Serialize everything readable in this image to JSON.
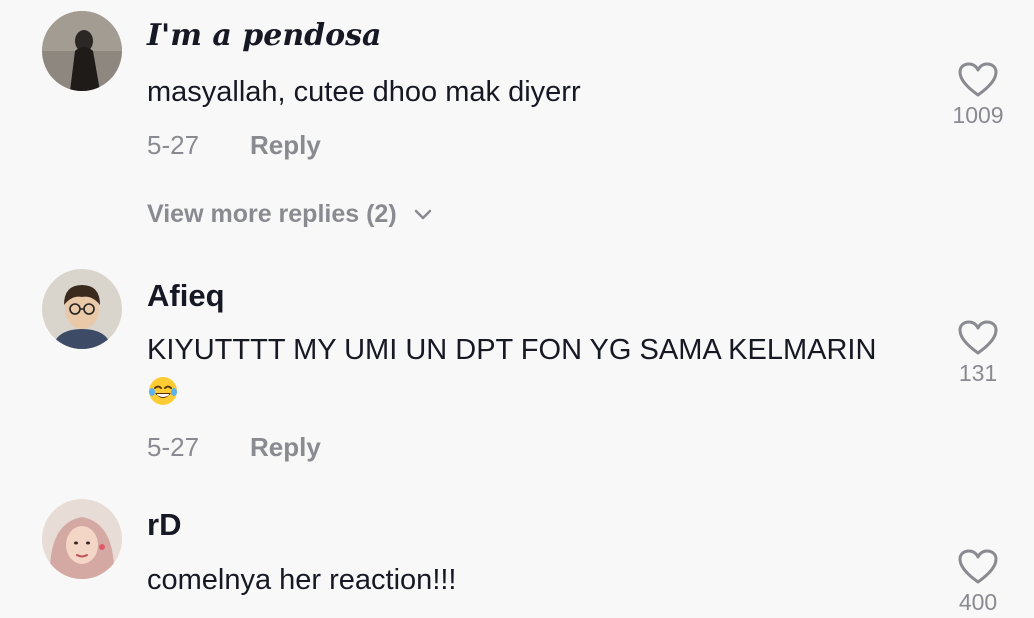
{
  "comments": [
    {
      "username": "I'm a pendosa",
      "text": "masyallah, cutee dhoo mak diyerr",
      "date": "5-27",
      "reply_label": "Reply",
      "likes": "1009",
      "avatar_icon": "dark-hooded-figure-avatar"
    },
    {
      "username": "Afieq",
      "text": "KIYUTTTT MY UMI UN DPT FON YG SAMA KELMARIN",
      "emoji": "face-with-tears-of-joy",
      "date": "5-27",
      "reply_label": "Reply",
      "likes": "131",
      "avatar_icon": "boy-with-glasses-avatar"
    },
    {
      "username": "rD",
      "text": "comelnya her reaction!!!",
      "likes": "400",
      "avatar_icon": "girl-with-hijab-avatar"
    }
  ],
  "view_more_replies": "View more replies (2)",
  "colors": {
    "background": "#f8f8f8",
    "primary_text": "#161823",
    "secondary_text": "#8a8b91"
  }
}
